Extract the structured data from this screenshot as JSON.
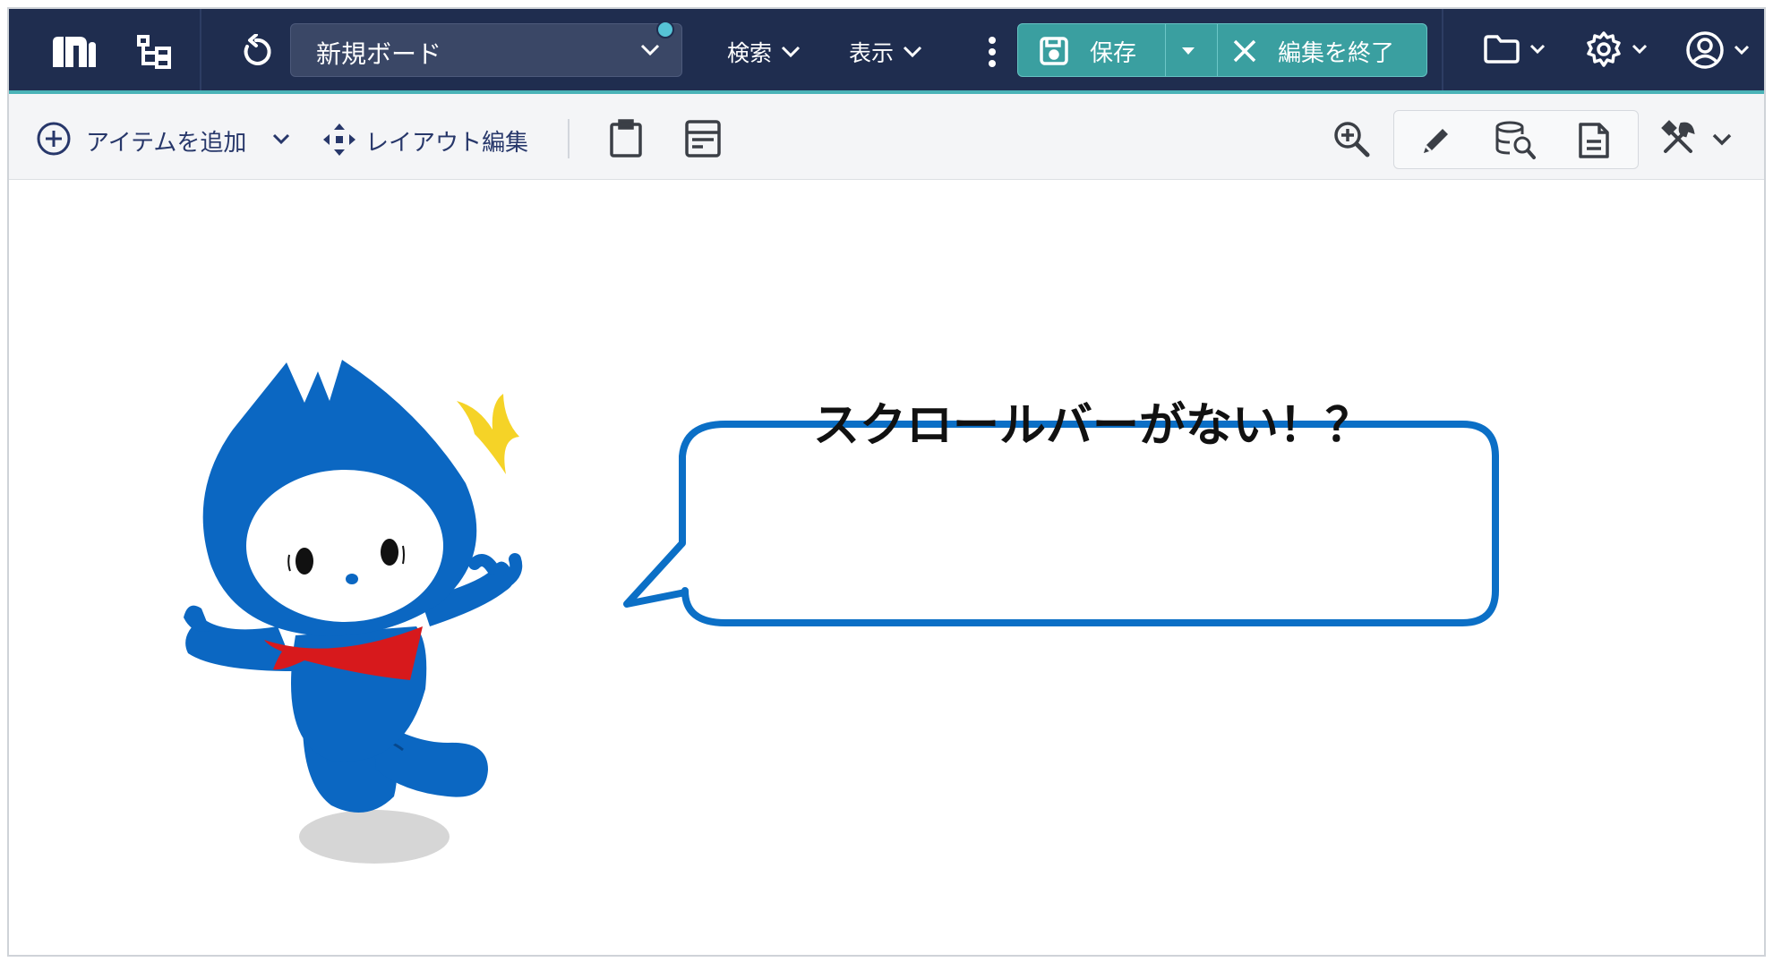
{
  "header": {
    "logo_icon": "m-logo-icon",
    "tree_icon": "hierarchy-tree-icon",
    "refresh_icon": "refresh-icon",
    "board_title": "新規ボード",
    "search_menu": "検索",
    "view_menu": "表示",
    "more_icon": "vertical-dots-icon",
    "save_label": "保存",
    "end_edit_label": "編集を終了",
    "folder_icon": "folder-icon",
    "settings_icon": "gear-icon",
    "account_icon": "user-circle-icon",
    "colors": {
      "bar": "#1f2d4f",
      "accent": "#3a9fa0",
      "underline": "#4ab3b7"
    }
  },
  "toolbar": {
    "add_item_label": "アイテムを追加",
    "layout_edit_label": "レイアウト編集",
    "clipboard_icon": "clipboard-icon",
    "panel_icon": "panel-layout-icon",
    "zoom_icon": "zoom-in-icon",
    "edit_icon": "pencil-icon",
    "data_search_icon": "database-search-icon",
    "document_icon": "document-icon",
    "tools_icon": "tools-icon"
  },
  "content": {
    "speech_text": "スクロールバーがない！？",
    "mascot": "blue-mascot-character"
  }
}
